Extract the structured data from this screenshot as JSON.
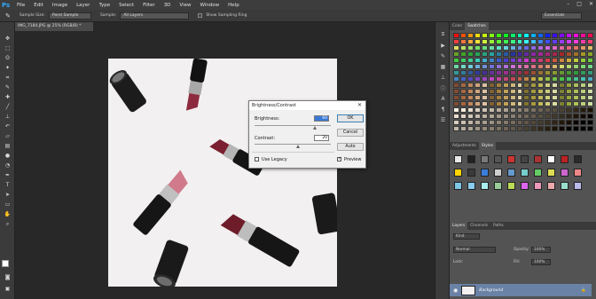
{
  "app": {
    "logo": "Ps"
  },
  "menu": [
    "File",
    "Edit",
    "Image",
    "Layer",
    "Type",
    "Select",
    "Filter",
    "3D",
    "View",
    "Window",
    "Help"
  ],
  "options": {
    "sample_size_label": "Sample Size:",
    "sample_size_value": "Point Sample",
    "sample_label": "Sample:",
    "sample_value": "All Layers",
    "show_ring_label": "Show Sampling Ring",
    "workspace": "Essentials"
  },
  "document": {
    "tab_title": "IMG_7184.JPG @ 25% (RGB/8) *"
  },
  "dialog": {
    "title": "Brightness/Contrast",
    "brightness_label": "Brightness:",
    "brightness_value": "60",
    "contrast_label": "Contrast:",
    "contrast_value": "20",
    "legacy_label": "Use Legacy",
    "preview_label": "Preview",
    "ok": "OK",
    "cancel": "Cancel",
    "auto": "Auto",
    "close": "✕"
  },
  "panels": {
    "color_tabs": [
      "Color",
      "Swatches"
    ],
    "style_tabs": [
      "Adjustments",
      "Styles"
    ],
    "layer_tabs": [
      "Layers",
      "Channels",
      "Paths"
    ],
    "layer_kind": "Kind",
    "blend_mode": "Normal",
    "opacity_label": "Opacity:",
    "opacity_value": "100%",
    "lock_label": "Lock:",
    "fill_label": "Fill:",
    "fill_value": "100%",
    "layer_name": "Background"
  }
}
